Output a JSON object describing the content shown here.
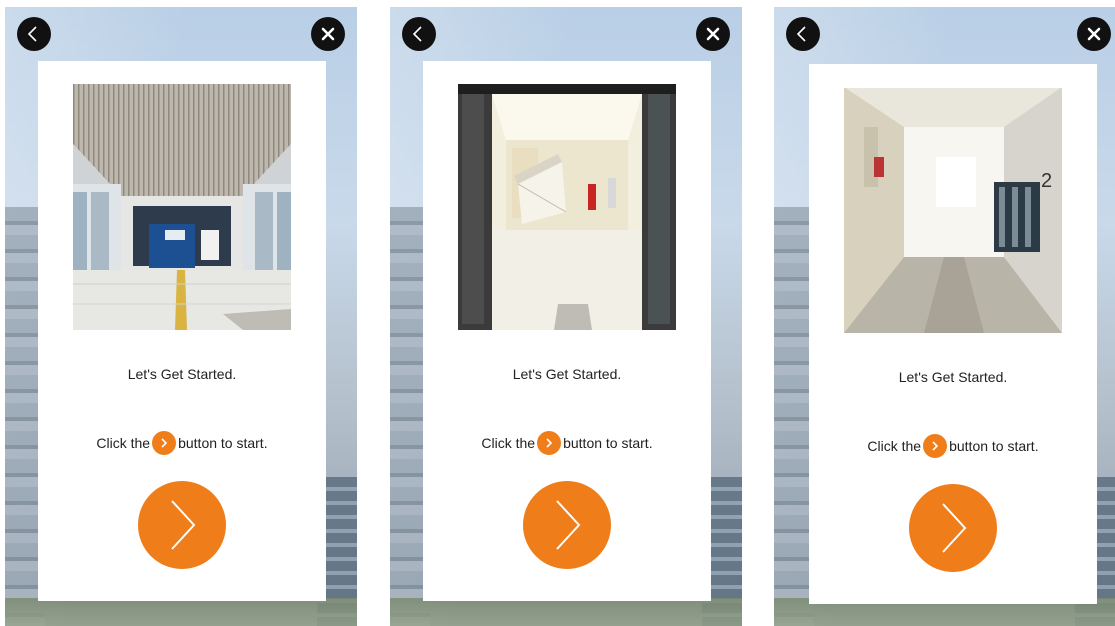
{
  "screens": [
    {
      "title": "Let's Get Started.",
      "instruction_before": "Click the",
      "instruction_after": "button to start.",
      "photo": "lobby-entrance",
      "icons": {
        "back": "back-chevron-icon",
        "close": "close-x-icon",
        "start": "chevron-right-icon"
      }
    },
    {
      "title": "Let's Get Started.",
      "instruction_before": "Click the",
      "instruction_after": "button to start.",
      "photo": "elevator-door-view",
      "icons": {
        "back": "back-chevron-icon",
        "close": "close-x-icon",
        "start": "chevron-right-icon"
      }
    },
    {
      "title": "Let's Get Started.",
      "instruction_before": "Click the",
      "instruction_after": "button to start.",
      "photo": "corridor-floor-2",
      "icons": {
        "back": "back-chevron-icon",
        "close": "close-x-icon",
        "start": "chevron-right-icon"
      }
    }
  ],
  "colors": {
    "accent": "#ef7d1a",
    "button_dark": "#111111",
    "card": "#ffffff"
  }
}
